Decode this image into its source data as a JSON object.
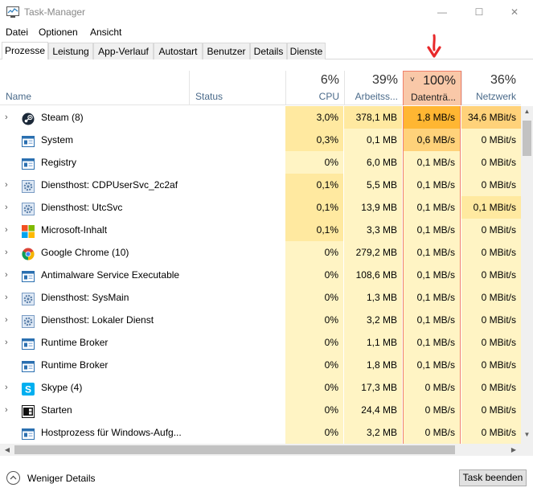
{
  "window": {
    "title": "Task-Manager",
    "min_glyph": "—",
    "max_glyph": "☐",
    "close_glyph": "✕"
  },
  "menu": [
    "Datei",
    "Optionen",
    "Ansicht"
  ],
  "tabs": [
    "Prozesse",
    "Leistung",
    "App-Verlauf",
    "Autostart",
    "Benutzer",
    "Details",
    "Dienste"
  ],
  "active_tab": "Prozesse",
  "columns": {
    "name": {
      "label": "Name"
    },
    "status": {
      "label": "Status"
    },
    "cpu": {
      "pct": "6%",
      "label": "CPU"
    },
    "mem": {
      "pct": "39%",
      "label": "Arbeitss..."
    },
    "disk": {
      "pct": "100%",
      "label": "Datenträ...",
      "sort_glyph": "˅"
    },
    "net": {
      "pct": "36%",
      "label": "Netzwerk"
    }
  },
  "processes": [
    {
      "expand": "›",
      "icon": "steam-icon",
      "name": "Steam (8)",
      "cpu": "3,0%",
      "mem": "378,1 MB",
      "disk": "1,8 MB/s",
      "net": "34,6 MBit/s"
    },
    {
      "expand": "",
      "icon": "window-icon",
      "name": "System",
      "cpu": "0,3%",
      "mem": "0,1 MB",
      "disk": "0,6 MB/s",
      "net": "0 MBit/s"
    },
    {
      "expand": "",
      "icon": "window-icon",
      "name": "Registry",
      "cpu": "0%",
      "mem": "6,0 MB",
      "disk": "0,1 MB/s",
      "net": "0 MBit/s"
    },
    {
      "expand": "›",
      "icon": "gear-icon",
      "name": "Diensthost: CDPUserSvc_2c2af",
      "cpu": "0,1%",
      "mem": "5,5 MB",
      "disk": "0,1 MB/s",
      "net": "0 MBit/s"
    },
    {
      "expand": "›",
      "icon": "gear-icon",
      "name": "Diensthost: UtcSvc",
      "cpu": "0,1%",
      "mem": "13,9 MB",
      "disk": "0,1 MB/s",
      "net": "0,1 MBit/s"
    },
    {
      "expand": "›",
      "icon": "microsoft-icon",
      "name": "Microsoft-Inhalt",
      "cpu": "0,1%",
      "mem": "3,3 MB",
      "disk": "0,1 MB/s",
      "net": "0 MBit/s"
    },
    {
      "expand": "›",
      "icon": "chrome-icon",
      "name": "Google Chrome (10)",
      "cpu": "0%",
      "mem": "279,2 MB",
      "disk": "0,1 MB/s",
      "net": "0 MBit/s"
    },
    {
      "expand": "›",
      "icon": "window-icon",
      "name": "Antimalware Service Executable",
      "cpu": "0%",
      "mem": "108,6 MB",
      "disk": "0,1 MB/s",
      "net": "0 MBit/s"
    },
    {
      "expand": "›",
      "icon": "gear-icon",
      "name": "Diensthost: SysMain",
      "cpu": "0%",
      "mem": "1,3 MB",
      "disk": "0,1 MB/s",
      "net": "0 MBit/s"
    },
    {
      "expand": "›",
      "icon": "gear-icon",
      "name": "Diensthost: Lokaler Dienst",
      "cpu": "0%",
      "mem": "3,2 MB",
      "disk": "0,1 MB/s",
      "net": "0 MBit/s"
    },
    {
      "expand": "›",
      "icon": "window-icon",
      "name": "Runtime Broker",
      "cpu": "0%",
      "mem": "1,1 MB",
      "disk": "0,1 MB/s",
      "net": "0 MBit/s"
    },
    {
      "expand": "",
      "icon": "window-icon",
      "name": "Runtime Broker",
      "cpu": "0%",
      "mem": "1,8 MB",
      "disk": "0,1 MB/s",
      "net": "0 MBit/s"
    },
    {
      "expand": "›",
      "icon": "skype-icon",
      "name": "Skype (4)",
      "cpu": "0%",
      "mem": "17,3 MB",
      "disk": "0 MB/s",
      "net": "0 MBit/s",
      "leaf": true
    },
    {
      "expand": "›",
      "icon": "start-icon",
      "name": "Starten",
      "cpu": "0%",
      "mem": "24,4 MB",
      "disk": "0 MB/s",
      "net": "0 MBit/s"
    },
    {
      "expand": "",
      "icon": "window-icon",
      "name": "Hostprozess für Windows-Aufg...",
      "cpu": "0%",
      "mem": "3,2 MB",
      "disk": "0 MB/s",
      "net": "0 MBit/s"
    }
  ],
  "footer": {
    "fewer_details": "Weniger Details",
    "end_task": "Task beenden"
  },
  "colors": {
    "accent_orange": "#f0806a",
    "heat_low": "#fff4c4",
    "heat_high": "#ffb632",
    "annotation_red": "#e8282a"
  }
}
